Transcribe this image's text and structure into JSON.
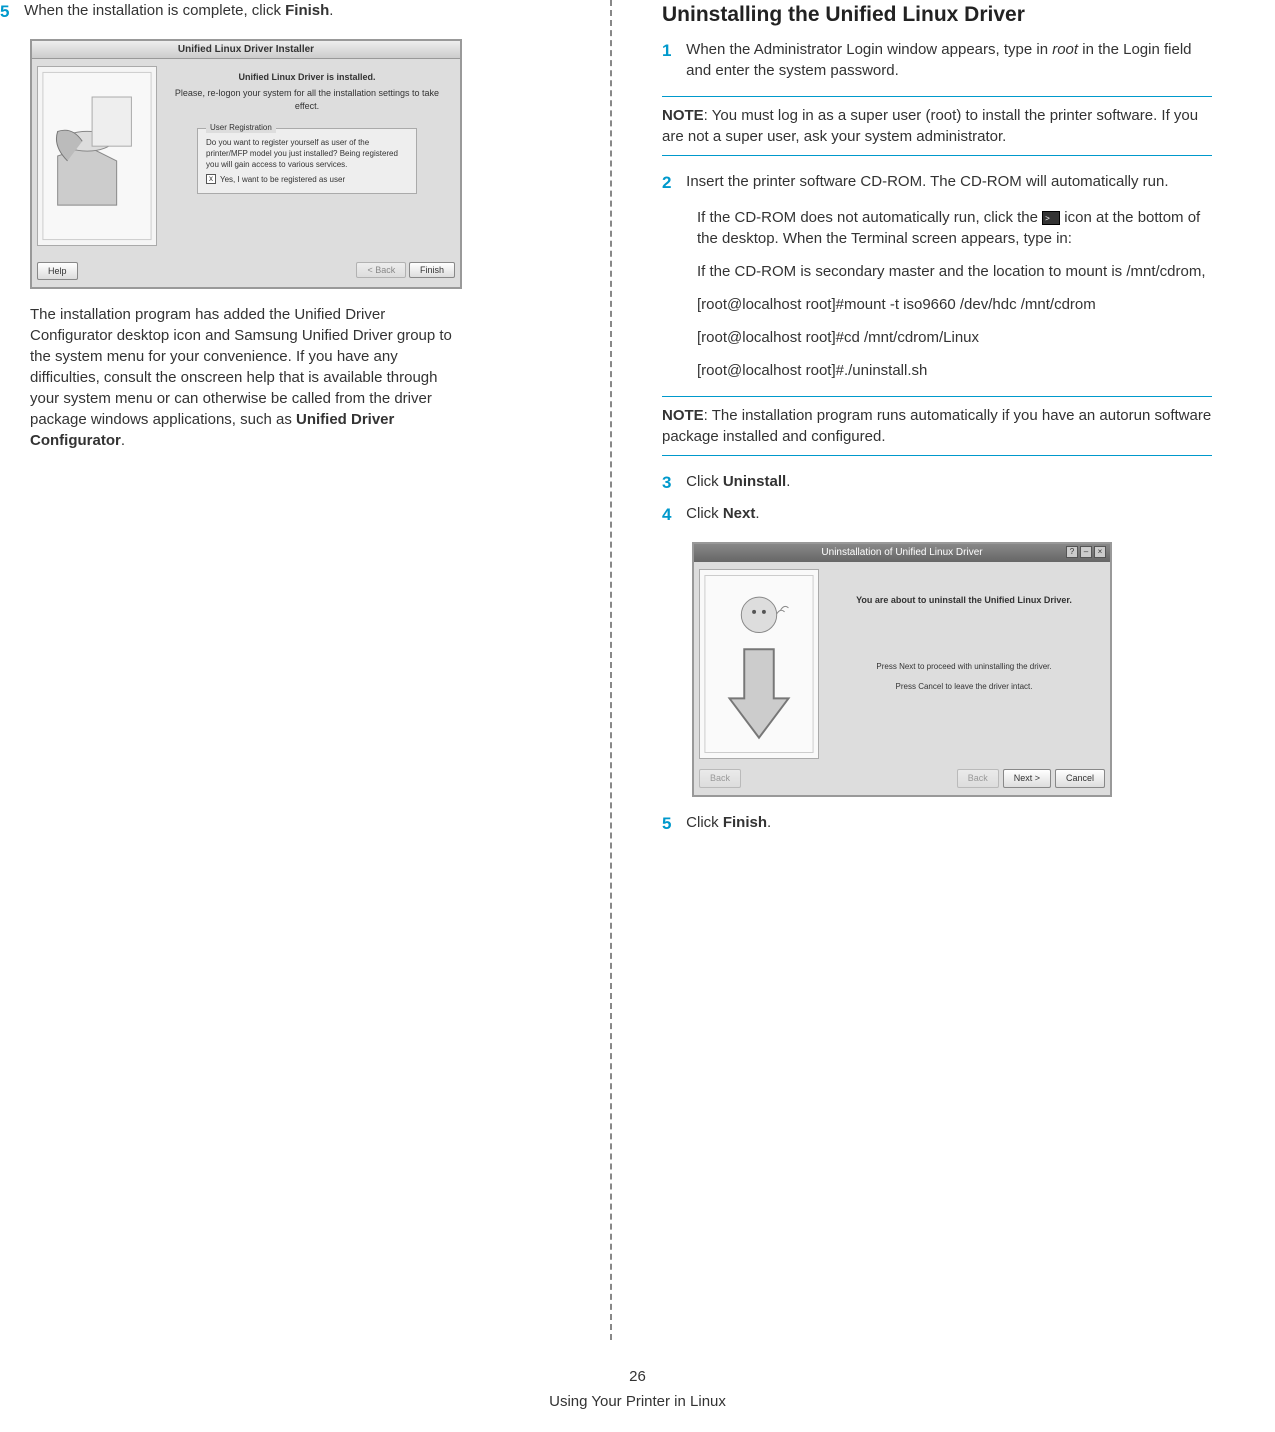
{
  "left": {
    "step5_num": "5",
    "step5_text_pre": "When the installation is complete, click ",
    "step5_text_bold": "Finish",
    "step5_text_post": ".",
    "screenshot1": {
      "title": "Unified Linux Driver Installer",
      "header": "Unified Linux Driver is installed.",
      "subheader": "Please, re-logon your system for all the installation settings to take effect.",
      "reg_title": "User Registration",
      "reg_q": "Do you want to register yourself as user of the printer/MFP model you just installed? Being registered you will gain access to various services.",
      "reg_checkbox": "Yes, I want to be registered as user",
      "help_btn": "Help",
      "back_btn": "< Back",
      "finish_btn": "Finish"
    },
    "post_text_1": "The installation program has added the Unified Driver Configurator desktop icon and Samsung Unified Driver group to the system menu for your convenience. If you have any difficulties, consult the onscreen help that is available through your system menu or can otherwise be called from the driver package windows applications, such as ",
    "post_text_bold": "Unified Driver Configurator",
    "post_text_2": "."
  },
  "right": {
    "title": "Uninstalling the Unified Linux Driver",
    "step1_num": "1",
    "step1_text_pre": "When the Administrator Login window appears, type in ",
    "step1_italic": "root",
    "step1_text_post": " in the Login field and enter the system password.",
    "note1_label": "NOTE",
    "note1_text": ": You must log in as a super user (root) to install the printer software. If you are not a super user, ask your system administrator.",
    "step2_num": "2",
    "step2_text": "Insert the printer software CD-ROM. The CD-ROM will automatically run.",
    "sub1_pre": "If the CD-ROM does not automatically run, click the ",
    "sub1_post": " icon at the bottom of the desktop. When the Terminal screen appears, type in:",
    "sub2": "If the CD-ROM is secondary master and the location to mount is /mnt/cdrom,",
    "sub3": "[root@localhost root]#mount -t iso9660 /dev/hdc /mnt/cdrom",
    "sub4": "[root@localhost root]#cd /mnt/cdrom/Linux",
    "sub5": "[root@localhost root]#./uninstall.sh",
    "note2_label": "NOTE",
    "note2_text": ": The installation program runs automatically if you have an autorun software package installed and configured.",
    "step3_num": "3",
    "step3_pre": "Click ",
    "step3_bold": "Uninstall",
    "step3_post": ".",
    "step4_num": "4",
    "step4_pre": "Click ",
    "step4_bold": "Next",
    "step4_post": ".",
    "screenshot2": {
      "title": "Uninstallation of Unified Linux Driver",
      "line1": "You are about to uninstall the Unified Linux Driver.",
      "line2": "Press Next to proceed with uninstalling the driver.",
      "line3": "Press Cancel to leave the driver intact.",
      "back_btn": "Back",
      "next_btn": "Next >",
      "cancel_btn": "Cancel"
    },
    "step5_num": "5",
    "step5_pre": "Click ",
    "step5_bold": "Finish",
    "step5_post": "."
  },
  "footer": {
    "page": "26",
    "section": "Using Your Printer in Linux"
  }
}
